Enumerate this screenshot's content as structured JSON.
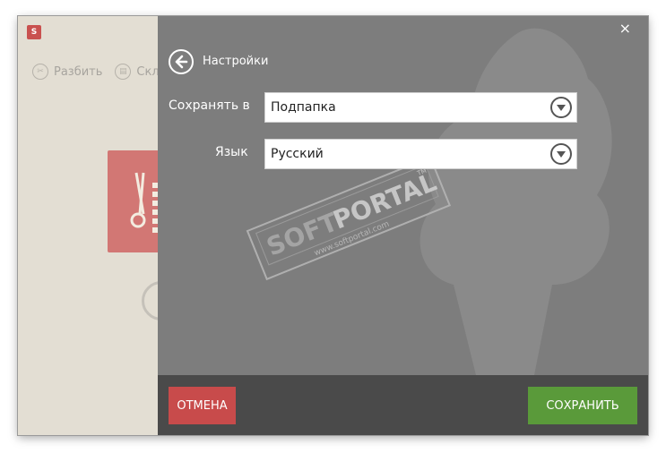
{
  "app": {
    "logo_text": "S",
    "toolbar": [
      {
        "label": "Разбить",
        "icon": "scissors-icon"
      },
      {
        "label": "Скле",
        "icon": "glue-icon"
      }
    ]
  },
  "settings": {
    "title": "Настройки",
    "save_to_label": "Сохранять в",
    "save_to_value": "Подпапка",
    "language_label": "Язык",
    "language_value": "Русский",
    "close_glyph": "×",
    "cancel_label": "ОТМЕНА",
    "save_label": "СОХРАНИТЬ"
  },
  "watermark": {
    "brand": "PORTAL",
    "prefix": "SOFT",
    "url": "www.softportal.com",
    "tm": "TM"
  },
  "colors": {
    "panel": "#7d7d7d",
    "footer": "#4a4a4a",
    "cancel": "#c84b4b",
    "save": "#5a9a3a",
    "app_bg": "#e3ded3"
  }
}
